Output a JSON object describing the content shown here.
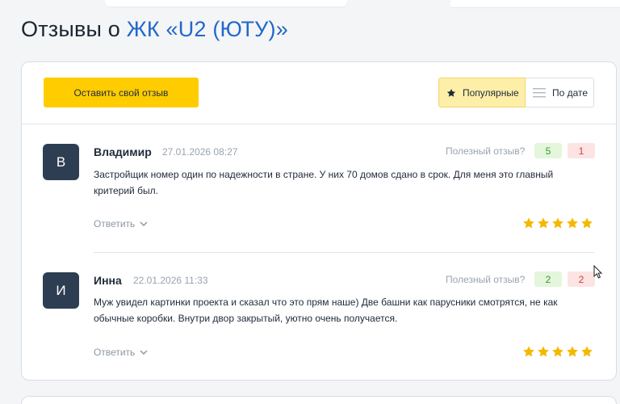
{
  "page": {
    "title_prefix": "Отзывы о ",
    "title_link": "ЖК «U2 (ЮТУ)»"
  },
  "toolbar": {
    "leave_review_label": "Оставить свой отзыв",
    "sort_popular_label": "Популярные",
    "sort_date_label": "По дате",
    "sort_active": "Популярные"
  },
  "colors": {
    "accent_yellow": "#ffcc00",
    "link_blue": "#2168c9",
    "star": "#f5b800",
    "avatar_bg": "#2e3e52"
  },
  "reviews": [
    {
      "initial": "В",
      "author": "Владимир",
      "date": "27.01.2026 08:27",
      "useful_label": "Полезный отзыв?",
      "likes": "5",
      "dislikes": "1",
      "text": "Застройщик номер один по надежности в стране. У них 70 домов сдано в срок. Для меня это главный критерий был.",
      "reply_label": "Ответить",
      "rating": 5
    },
    {
      "initial": "И",
      "author": "Инна",
      "date": "22.01.2026 11:33",
      "useful_label": "Полезный отзыв?",
      "likes": "2",
      "dislikes": "2",
      "text": "Муж увидел картинки проекта и сказал что это прям наше) Две башни как парусники смотрятся, не как обычные коробки. Внутри двор закрытый, уютно очень получается.",
      "reply_label": "Ответить",
      "rating": 5
    }
  ]
}
